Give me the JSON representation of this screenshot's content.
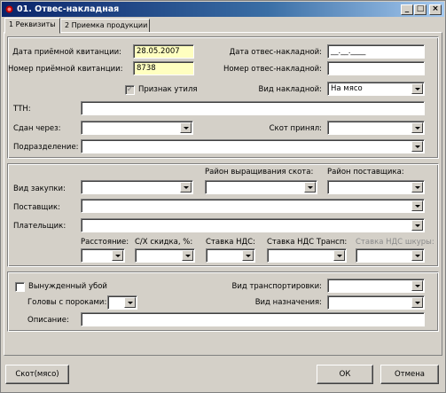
{
  "window": {
    "title": "01. Отвес-накладная",
    "minimize": "_",
    "maximize": "□",
    "close": "×"
  },
  "tabs": [
    {
      "label": "1 Реквизиты"
    },
    {
      "label": "2 Приемка продукции"
    }
  ],
  "section1": {
    "receipt_date_label": "Дата приёмной квитанции:",
    "receipt_date_value": "28.05.2007",
    "weigh_date_label": "Дата отвес-накладной:",
    "weigh_date_value": "__.__.____",
    "receipt_num_label": "Номер приёмной квитанции:",
    "receipt_num_value": "8738",
    "weigh_num_label": "Номер отвес-накладной:",
    "weigh_num_value": "",
    "util_label": "Признак утиля",
    "util_checked": true,
    "invoice_type_label": "Вид накладной:",
    "invoice_type_value": "На мясо",
    "ttn_label": "ТТН:",
    "handed_via_label": "Сдан через:",
    "cattle_received_label": "Скот принял:",
    "division_label": "Подразделение:"
  },
  "section2": {
    "region_cattle_label": "Район выращивания скота:",
    "region_supplier_label": "Район поставщика:",
    "purchase_type_label": "Вид закупки:",
    "supplier_label": "Поставщик:",
    "payer_label": "Плательщик:",
    "distance_label": "Расстояние:",
    "discount_label": "С/Х скидка, %:",
    "vat_label": "Ставка НДС:",
    "vat_transport_label": "Ставка НДС Трансп:",
    "vat_skins_label": "Ставка НДС шкуры:"
  },
  "section3": {
    "forced_label": "Вынужденный убой",
    "forced_checked": false,
    "transport_type_label": "Вид транспортировки:",
    "heads_defects_label": "Головы с пороками:",
    "destination_label": "Вид назначения:",
    "description_label": "Описание:"
  },
  "footer": {
    "cattle_button": "Скот(мясо)",
    "ok_button": "ОК",
    "cancel_button": "Отмена"
  }
}
